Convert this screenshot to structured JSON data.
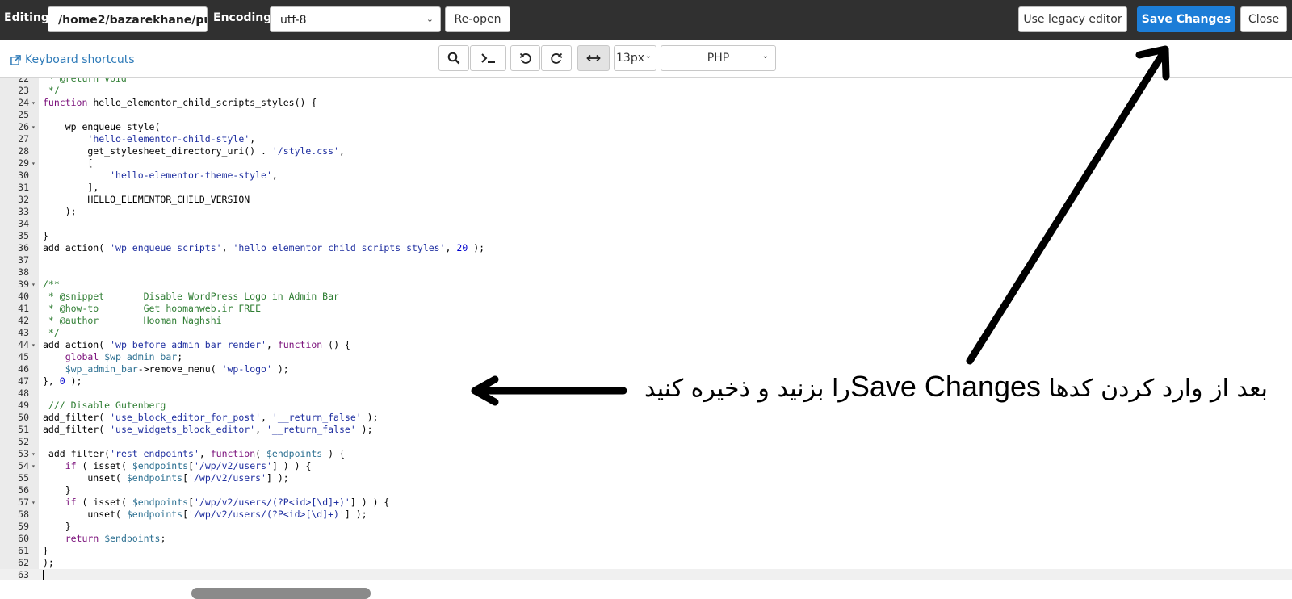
{
  "topbar": {
    "editing_label": "Editing:",
    "file_path": "/home2/bazarekhane/pu",
    "encoding_label": "Encoding:",
    "encoding_value": "utf-8",
    "reopen_label": "Re-open",
    "legacy_label": "Use legacy editor",
    "save_label": "Save Changes",
    "close_label": "Close",
    "accent_color": "#1c7dd7"
  },
  "toolbar": {
    "keyboard_shortcuts": "Keyboard shortcuts",
    "search_icon": "search-icon",
    "terminal_icon": "terminal-icon",
    "undo_icon": "undo-icon",
    "redo_icon": "redo-icon",
    "wrap_icon": "wrap-toggle-icon",
    "font_size": "13px",
    "language": "PHP"
  },
  "editor": {
    "lines": [
      {
        "n": "22",
        "fold": false,
        "html": "<span class=\"cm\"> * @return void</span>"
      },
      {
        "n": "23",
        "fold": false,
        "html": "<span class=\"cm\"> */</span>"
      },
      {
        "n": "24",
        "fold": true,
        "html": "<span class=\"kw\">function</span> hello_elementor_child_scripts_styles() {"
      },
      {
        "n": "25",
        "fold": false,
        "html": ""
      },
      {
        "n": "26",
        "fold": true,
        "html": "    wp_enqueue_style("
      },
      {
        "n": "27",
        "fold": false,
        "html": "        <span class=\"str\">'hello-elementor-child-style'</span>,"
      },
      {
        "n": "28",
        "fold": false,
        "html": "        get_stylesheet_directory_uri() . <span class=\"str\">'/style.css'</span>,"
      },
      {
        "n": "29",
        "fold": true,
        "html": "        ["
      },
      {
        "n": "30",
        "fold": false,
        "html": "            <span class=\"str\">'hello-elementor-theme-style'</span>,"
      },
      {
        "n": "31",
        "fold": false,
        "html": "        ],"
      },
      {
        "n": "32",
        "fold": false,
        "html": "        HELLO_ELEMENTOR_CHILD_VERSION"
      },
      {
        "n": "33",
        "fold": false,
        "html": "    );"
      },
      {
        "n": "34",
        "fold": false,
        "html": ""
      },
      {
        "n": "35",
        "fold": false,
        "html": "}"
      },
      {
        "n": "36",
        "fold": false,
        "html": "add_action( <span class=\"str\">'wp_enqueue_scripts'</span>, <span class=\"str\">'hello_elementor_child_scripts_styles'</span>, <span class=\"num\">20</span> );"
      },
      {
        "n": "37",
        "fold": false,
        "html": ""
      },
      {
        "n": "38",
        "fold": false,
        "html": ""
      },
      {
        "n": "39",
        "fold": true,
        "html": "<span class=\"cm\">/**</span>"
      },
      {
        "n": "40",
        "fold": false,
        "html": "<span class=\"cm\"> * @snippet       Disable WordPress Logo in Admin Bar</span>"
      },
      {
        "n": "41",
        "fold": false,
        "html": "<span class=\"cm\"> * @how-to        Get hoomanweb.ir FREE</span>"
      },
      {
        "n": "42",
        "fold": false,
        "html": "<span class=\"cm\"> * @author        Hooman Naghshi</span>"
      },
      {
        "n": "43",
        "fold": false,
        "html": "<span class=\"cm\"> */</span>"
      },
      {
        "n": "44",
        "fold": true,
        "html": "add_action( <span class=\"str\">'wp_before_admin_bar_render'</span>, <span class=\"kw\">function</span> () {"
      },
      {
        "n": "45",
        "fold": false,
        "html": "    <span class=\"kw\">global</span> <span class=\"var\">$wp_admin_bar</span>;"
      },
      {
        "n": "46",
        "fold": false,
        "html": "    <span class=\"var\">$wp_admin_bar</span>-&gt;remove_menu( <span class=\"str\">'wp-logo'</span> );"
      },
      {
        "n": "47",
        "fold": false,
        "html": "}, <span class=\"num\">0</span> );"
      },
      {
        "n": "48",
        "fold": false,
        "html": ""
      },
      {
        "n": "49",
        "fold": false,
        "html": " <span class=\"cm\">/// Disable Gutenberg</span>"
      },
      {
        "n": "50",
        "fold": false,
        "html": "add_filter( <span class=\"str\">'use_block_editor_for_post'</span>, <span class=\"str\">'__return_false'</span> );"
      },
      {
        "n": "51",
        "fold": false,
        "html": "add_filter( <span class=\"str\">'use_widgets_block_editor'</span>, <span class=\"str\">'__return_false'</span> );"
      },
      {
        "n": "52",
        "fold": false,
        "html": ""
      },
      {
        "n": "53",
        "fold": true,
        "html": " add_filter(<span class=\"str\">'rest_endpoints'</span>, <span class=\"kw\">function</span>( <span class=\"var\">$endpoints</span> ) {"
      },
      {
        "n": "54",
        "fold": true,
        "html": "    <span class=\"kw\">if</span> ( isset( <span class=\"var\">$endpoints</span>[<span class=\"str\">'/wp/v2/users'</span>] ) ) {"
      },
      {
        "n": "55",
        "fold": false,
        "html": "        unset( <span class=\"var\">$endpoints</span>[<span class=\"str\">'/wp/v2/users'</span>] );"
      },
      {
        "n": "56",
        "fold": false,
        "html": "    }"
      },
      {
        "n": "57",
        "fold": true,
        "html": "    <span class=\"kw\">if</span> ( isset( <span class=\"var\">$endpoints</span>[<span class=\"str\">'/wp/v2/users/(?P&lt;id&gt;[\\d]+)'</span>] ) ) {"
      },
      {
        "n": "58",
        "fold": false,
        "html": "        unset( <span class=\"var\">$endpoints</span>[<span class=\"str\">'/wp/v2/users/(?P&lt;id&gt;[\\d]+)'</span>] );"
      },
      {
        "n": "59",
        "fold": false,
        "html": "    }"
      },
      {
        "n": "60",
        "fold": false,
        "html": "    <span class=\"kw\">return</span> <span class=\"var\">$endpoints</span>;"
      },
      {
        "n": "61",
        "fold": false,
        "html": "}"
      },
      {
        "n": "62",
        "fold": false,
        "html": ");"
      },
      {
        "n": "63",
        "fold": false,
        "html": "",
        "cursor": true,
        "active": true
      }
    ]
  },
  "annotation": {
    "text_prefix": "بعد از وارد کردن کدها ",
    "text_highlight": "Save Changes",
    "text_suffix": "را بزنید و ذخیره کنید"
  }
}
